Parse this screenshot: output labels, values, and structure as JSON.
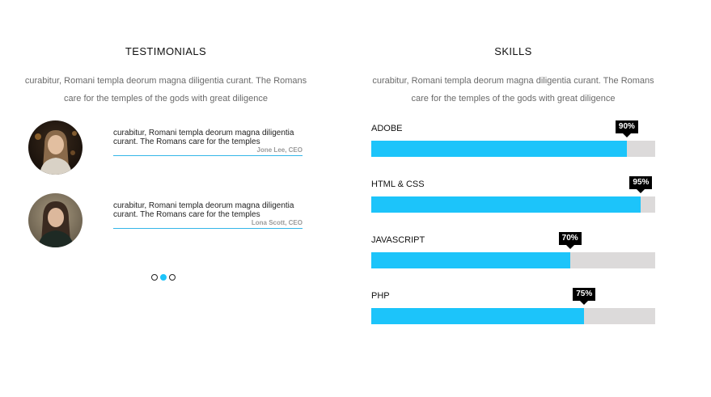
{
  "testimonials": {
    "title": "TESTIMONIALS",
    "intro_line1": "curabitur, Romani templa deorum magna diligentia curant. The Romans",
    "intro_line2": "care for the temples of the gods with great diligence",
    "items": [
      {
        "quote": "curabitur, Romani templa deorum magna diligentia curant. The Romans care for the temples",
        "author": "Jone Lee, CEO",
        "avatar_icon": "woman-portrait-avatar"
      },
      {
        "quote": "curabitur, Romani templa deorum magna diligentia curant. The Romans care for the temples",
        "author": "Lona Scott, CEO",
        "avatar_icon": "woman-portrait-avatar"
      }
    ],
    "pagination": {
      "count": 3,
      "active_index": 1
    }
  },
  "skills": {
    "title": "SKILLS",
    "intro_line1": "curabitur, Romani templa deorum magna diligentia curant. The Romans",
    "intro_line2": "care for the temples of the gods with great diligence",
    "items": [
      {
        "name": "ADOBE",
        "percent": 90,
        "percent_label": "90%"
      },
      {
        "name": "HTML & CSS",
        "percent": 95,
        "percent_label": "95%"
      },
      {
        "name": "JAVASCRIPT",
        "percent": 70,
        "percent_label": "70%"
      },
      {
        "name": "PHP",
        "percent": 75,
        "percent_label": "75%"
      }
    ]
  },
  "colors": {
    "accent": "#1cc4fa",
    "track": "#dcdada",
    "tag_bg": "#000000",
    "divider": "#34b6e8"
  }
}
